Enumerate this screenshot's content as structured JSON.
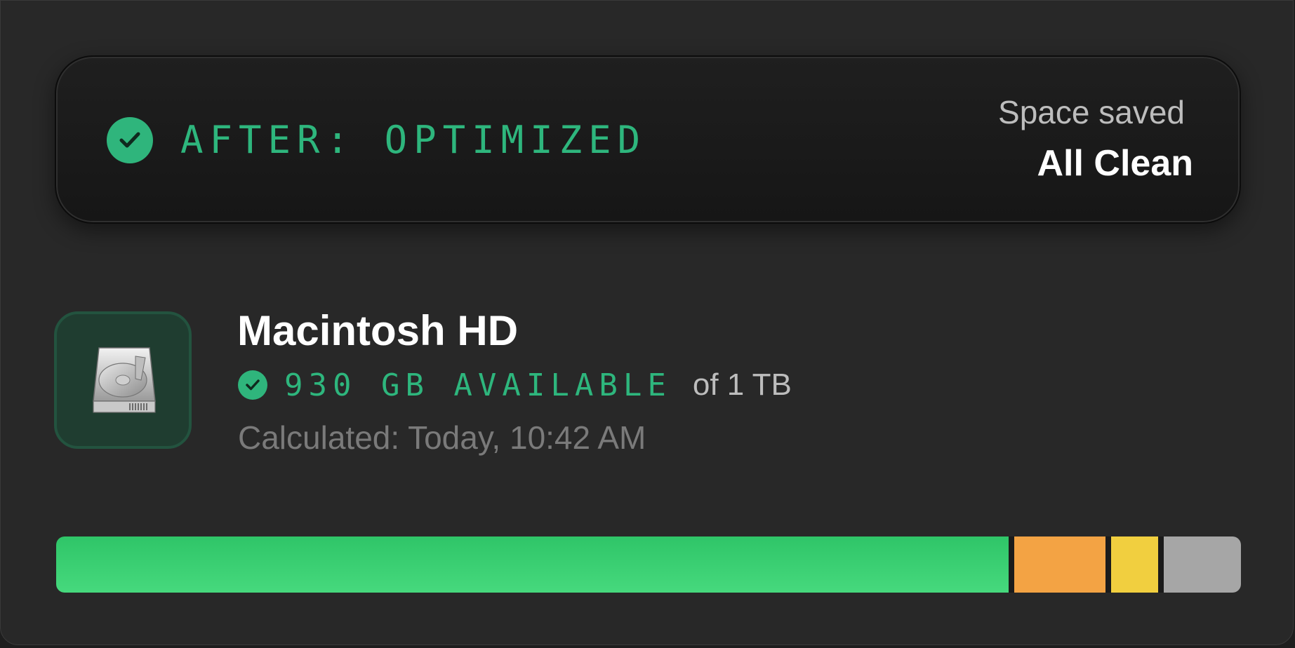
{
  "status": {
    "title": "AFTER: OPTIMIZED",
    "saved_label": "Space saved",
    "saved_value": "All Clean",
    "accent": "#2eb67d"
  },
  "disk": {
    "icon": "hard-drive-icon",
    "name": "Macintosh HD",
    "available": "930 GB AVAILABLE",
    "total": "of 1 TB",
    "calculated": "Calculated: Today, 10:42 AM"
  },
  "storage_bar": {
    "segments": [
      {
        "key": "available",
        "fraction": 0.805,
        "color": "#3ed273"
      },
      {
        "key": "orange",
        "fraction": 0.077,
        "color": "#f3a344"
      },
      {
        "key": "yellow",
        "fraction": 0.04,
        "color": "#f1cf3f"
      },
      {
        "key": "gray",
        "fraction": 0.065,
        "color": "#a6a6a6"
      }
    ]
  }
}
